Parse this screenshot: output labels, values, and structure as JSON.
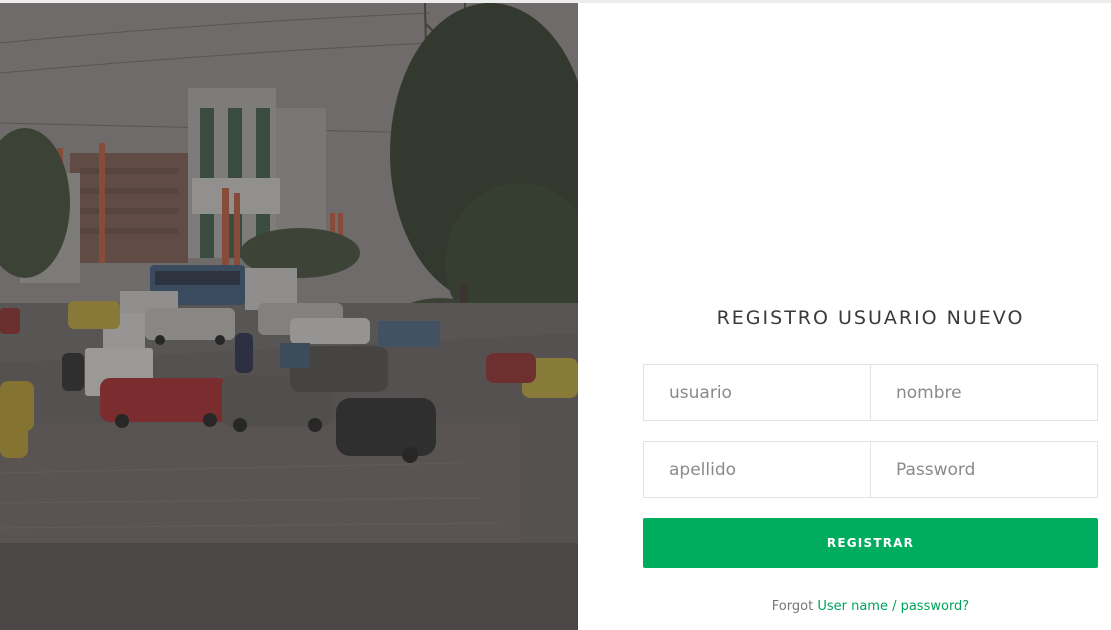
{
  "form": {
    "title": "REGISTRO USUARIO NUEVO",
    "usuario_placeholder": "usuario",
    "nombre_placeholder": "nombre",
    "apellido_placeholder": "apellido",
    "password_placeholder": "Password",
    "submit_label": "REGISTRAR",
    "forgot_prefix": "Forgot",
    "forgot_link": "User name / password?"
  },
  "colors": {
    "accent": "#00ad5f",
    "link": "#00a35b",
    "photo_overlay": "#3a3836"
  }
}
